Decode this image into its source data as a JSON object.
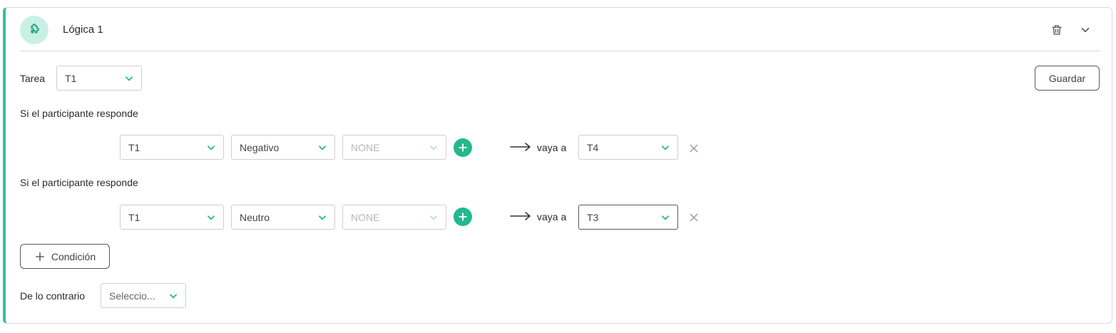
{
  "header": {
    "title": "Lógica 1",
    "icon": "puzzle-icon",
    "delete_icon": "trash-icon",
    "collapse_icon": "chevron-down-icon"
  },
  "task": {
    "label": "Tarea",
    "value": "T1"
  },
  "save_label": "Guardar",
  "conditions": [
    {
      "label": "Si el participante responde",
      "question": "T1",
      "answer": "Negativo",
      "extra": "NONE",
      "goto_label": "vaya a",
      "target": "T4"
    },
    {
      "label": "Si el participante responde",
      "question": "T1",
      "answer": "Neutro",
      "extra": "NONE",
      "goto_label": "vaya a",
      "target": "T3"
    }
  ],
  "add_condition_label": "Condición",
  "otherwise": {
    "label": "De lo contrario",
    "value": "Seleccio..."
  },
  "colors": {
    "accent": "#22b98f",
    "accent_light": "#c8f1e4",
    "border": "#cfcfcf"
  }
}
